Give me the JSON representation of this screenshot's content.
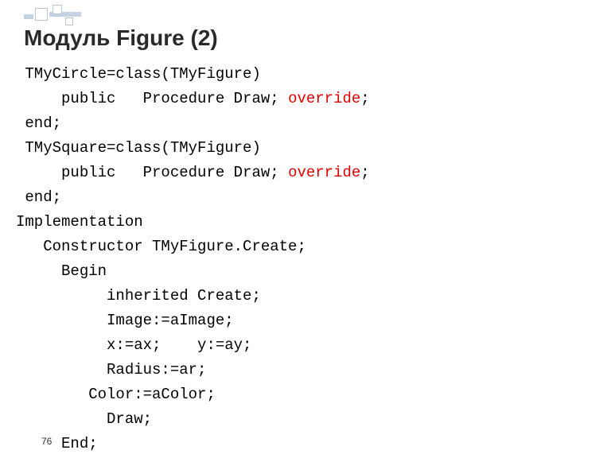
{
  "title": "Модуль Figure (2)",
  "page_number": "76",
  "code": {
    "l1a": " TMyCircle=class(TMyFigure)",
    "l2a": "     public   Procedure Draw; ",
    "l2b": "override",
    "l2c": ";",
    "l3a": " end;",
    "l4a": " TMySquare=class(TMyFigure)",
    "l5a": "     public   Procedure Draw; ",
    "l5b": "override",
    "l5c": ";",
    "l6a": " end;",
    "l7a": "Implementation",
    "l8a": "   Constructor TMyFigure.Create;",
    "l9a": "     Begin",
    "l10a": "          inherited Create;",
    "l11a": "          Image:=aImage;",
    "l12a": "          x:=ax;    y:=ay;",
    "l13a": "          Radius:=ar;",
    "l14a": "        Color:=aColor;",
    "l15a": "          Draw;",
    "l16a": "     End;"
  }
}
